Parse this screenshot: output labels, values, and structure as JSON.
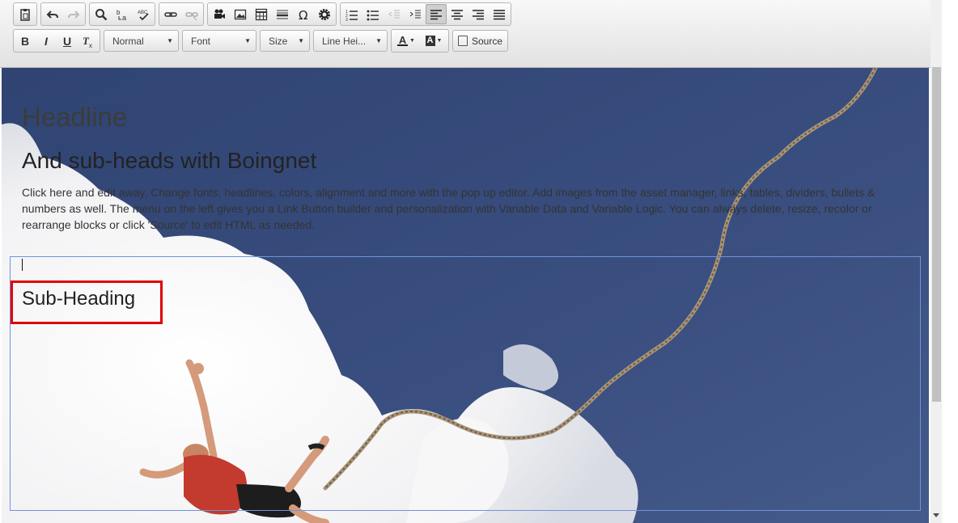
{
  "toolbar": {
    "row1_groups": [
      [
        {
          "icon": "paste-icon",
          "name": "paste-button",
          "glyph": "📋",
          "disabled": false
        }
      ],
      [
        {
          "icon": "undo-icon",
          "name": "undo-button",
          "glyph": "↶",
          "disabled": false
        },
        {
          "icon": "redo-icon",
          "name": "redo-button",
          "glyph": "↷",
          "disabled": true
        }
      ],
      [
        {
          "icon": "search-icon",
          "name": "find-button",
          "glyph": "find",
          "disabled": false
        },
        {
          "icon": "replace-icon",
          "name": "replace-button",
          "glyph": "b↕a",
          "disabled": false
        },
        {
          "icon": "spellcheck-icon",
          "name": "spellcheck-button",
          "glyph": "ABC✓",
          "disabled": false
        }
      ],
      [
        {
          "icon": "link-icon",
          "name": "link-button",
          "glyph": "link",
          "disabled": false
        },
        {
          "icon": "unlink-icon",
          "name": "unlink-button",
          "glyph": "unlink",
          "disabled": true
        }
      ],
      [
        {
          "icon": "video-icon",
          "name": "video-button",
          "glyph": "video",
          "disabled": false
        },
        {
          "icon": "image-icon",
          "name": "image-button",
          "glyph": "image",
          "disabled": false
        },
        {
          "icon": "table-icon",
          "name": "table-button",
          "glyph": "table",
          "disabled": false
        },
        {
          "icon": "horizontal-rule-icon",
          "name": "horizontal-rule-button",
          "glyph": "hr",
          "disabled": false
        },
        {
          "icon": "omega-icon",
          "name": "special-char-button",
          "glyph": "Ω",
          "disabled": false
        },
        {
          "icon": "gear-icon",
          "name": "settings-button",
          "glyph": "gear",
          "disabled": false
        }
      ],
      [
        {
          "icon": "numbered-list-icon",
          "name": "numbered-list-button",
          "glyph": "ol",
          "disabled": false
        },
        {
          "icon": "bulleted-list-icon",
          "name": "bulleted-list-button",
          "glyph": "ul",
          "disabled": false
        },
        {
          "icon": "outdent-icon",
          "name": "outdent-button",
          "glyph": "outdent",
          "disabled": true
        },
        {
          "icon": "indent-icon",
          "name": "indent-button",
          "glyph": "indent",
          "disabled": false
        },
        {
          "icon": "align-left-icon",
          "name": "align-left-button",
          "glyph": "left",
          "disabled": false,
          "active": true
        },
        {
          "icon": "align-center-icon",
          "name": "align-center-button",
          "glyph": "center",
          "disabled": false
        },
        {
          "icon": "align-right-icon",
          "name": "align-right-button",
          "glyph": "right",
          "disabled": false
        },
        {
          "icon": "justify-icon",
          "name": "justify-button",
          "glyph": "justify",
          "disabled": false
        }
      ]
    ],
    "bold": "B",
    "italic": "I",
    "underline": "U",
    "format_label": "Normal",
    "font_label": "Font",
    "size_label": "Size",
    "line_height_label": "Line Hei...",
    "text_color_label": "A",
    "bg_color_label": "A",
    "source_label": "Source"
  },
  "content": {
    "headline": "Headline",
    "subhead": "And sub-heads with Boingnet",
    "paragraph": "Click here and edit away. Change fonts, headlines, colors, alignment and more with the pop up editor. Add images from the asset manager, links, tables, dividers, bullets & numbers as well. The menu on the left gives you a Link Button builder and personalization with Variable Data and Variable Logic. You can always delete, resize, recolor or rearrange blocks or click 'Source' to edit HTML as needed.",
    "sub_heading": "Sub-Heading"
  },
  "colors": {
    "sky": "#3a4e7a",
    "highlight": "#e00000",
    "selection_border": "#6e94d8"
  }
}
